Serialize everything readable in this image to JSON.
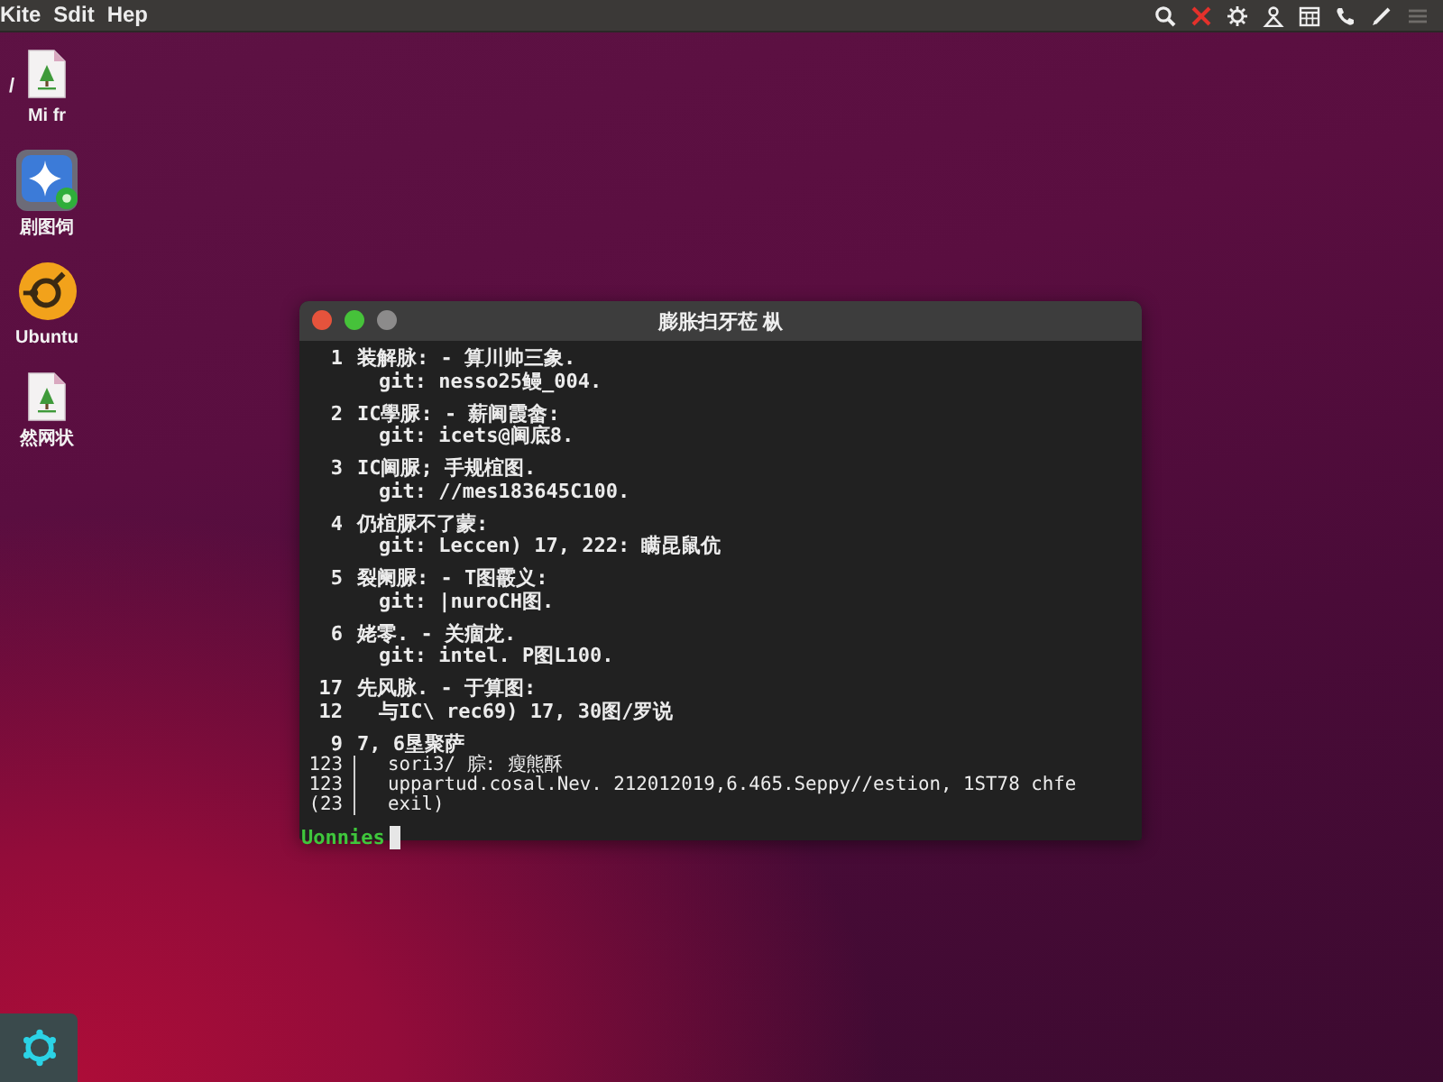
{
  "menu_bar": {
    "menus": [
      "Kite",
      "Sdit",
      "Hep"
    ]
  },
  "desktop_icons": [
    {
      "kind": "file",
      "label": "Mi fr",
      "tag": "/"
    },
    {
      "kind": "app",
      "label": "剧图饲"
    },
    {
      "kind": "logo",
      "label": "Ubuntu"
    },
    {
      "kind": "file",
      "label": "然网状"
    }
  ],
  "terminal": {
    "title": "膨胀扫牙莅 枞",
    "entries": [
      {
        "rows": [
          {
            "kind": "head",
            "number": "1",
            "text": "装解脉: - 算川帅三象."
          },
          {
            "kind": "sub",
            "text": "git: nesso25鳗_004."
          }
        ]
      },
      {
        "rows": [
          {
            "kind": "head",
            "number": "2",
            "text": "IC學脲: - 薪阃霞畲:"
          },
          {
            "kind": "sub",
            "text": "git: icets@阃底8."
          }
        ]
      },
      {
        "rows": [
          {
            "kind": "head",
            "number": "3",
            "text": "IC阃脲; 手规椬图."
          },
          {
            "kind": "sub",
            "text": "git: //mes183645C100."
          }
        ]
      },
      {
        "rows": [
          {
            "kind": "head",
            "number": "4",
            "text": "仍椬脲不了蒙:"
          },
          {
            "kind": "sub",
            "text": "git: Leccen) 17, 222: 瞒昆鼠伉"
          }
        ]
      },
      {
        "rows": [
          {
            "kind": "head",
            "number": "5",
            "text": "裂阑脲: - T图霰义:"
          },
          {
            "kind": "sub",
            "text": "git: |nuroCH图."
          }
        ]
      },
      {
        "rows": [
          {
            "kind": "head",
            "number": "6",
            "text": "姥零. - 关痼龙."
          },
          {
            "kind": "sub",
            "text": "git: intel. P图L100."
          }
        ]
      },
      {
        "rows": [
          {
            "kind": "head",
            "number": "17",
            "text": "先风脉. - 于算图:"
          },
          {
            "kind": "sub",
            "number": "12",
            "text": "与IC\\ rec69) 17, 30图/罗说"
          }
        ]
      },
      {
        "rows": [
          {
            "kind": "head",
            "number": "9",
            "text": "7, 6垦聚萨"
          },
          {
            "kind": "log",
            "number": "123",
            "text": "sori3/ 腙: 瘦熊酥"
          },
          {
            "kind": "log",
            "number": "123",
            "text": "uppartud.cosal.Nev. 212012019,6.465.Seppy//estion, 1ST78 chfe"
          },
          {
            "kind": "log",
            "number": "(23",
            "text": "exil)"
          }
        ]
      }
    ],
    "prompt": "Uonnies"
  }
}
